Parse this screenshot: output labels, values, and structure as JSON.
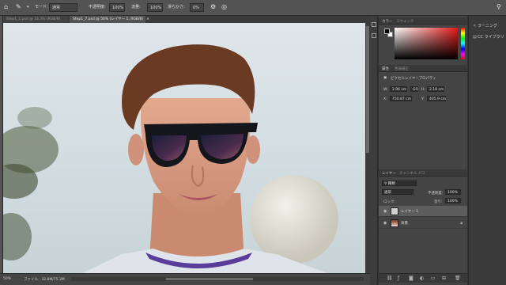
{
  "options_bar": {
    "home_icon": "home-icon",
    "mode_label": "モード:",
    "mode_value": "通常",
    "opacity_label": "不透明度:",
    "opacity_value": "100%",
    "flow_label": "流量:",
    "flow_value": "100%",
    "smoothing_label": "滑らかさ:",
    "smoothing_value": "0%"
  },
  "tabs": [
    {
      "label": "Step1_1.psd @ 33.3% (RGB/8)",
      "active": false
    },
    {
      "label": "Step1_7.psd @ 50% (レイヤー 1, RGB/8)",
      "active": true
    }
  ],
  "tab_close": "×",
  "status_bar": {
    "zoom": "50%",
    "doc_info": "ファイル : 32.8M/75.3M"
  },
  "color_panel": {
    "tabs": [
      "カラー",
      "スウォッチ"
    ],
    "foreground": "#000000",
    "background": "#ffffff"
  },
  "properties_panel": {
    "tabs": [
      "属性",
      "色調補正"
    ],
    "subtitle": "ピクセルレイヤープロパティ",
    "w_label": "W:",
    "w_value": "2.96 cm",
    "link_label": "GO",
    "h_label": "H:",
    "h_value": "2.18 cm",
    "x_label": "X:",
    "x_value": "750.87 cm",
    "y_label": "Y:",
    "y_value": "405.9 cm"
  },
  "layers_panel": {
    "tabs": [
      "レイヤー",
      "チャンネル",
      "パス"
    ],
    "filter_label": "種類",
    "blend_mode": "通常",
    "opacity_label": "不透明度:",
    "opacity_value": "100%",
    "lock_label": "ロック:",
    "fill_label": "塗り:",
    "fill_value": "100%",
    "layers": [
      {
        "name": "レイヤー 1",
        "selected": true
      },
      {
        "name": "背景",
        "selected": false
      }
    ]
  },
  "right_column": {
    "items": [
      "ラーニング",
      "CC ライブラリ"
    ]
  }
}
